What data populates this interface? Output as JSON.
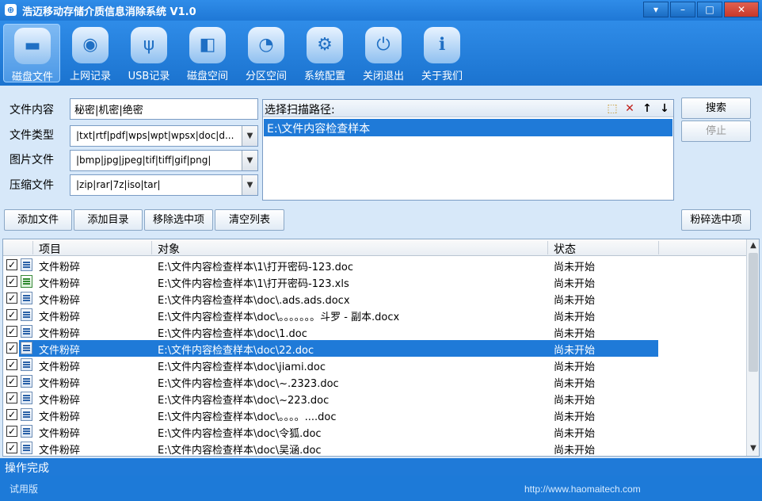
{
  "window": {
    "title": "浩迈移动存储介质信息消除系统 V1.0",
    "controls": {
      "menu": "▾",
      "min": "–",
      "max": "□",
      "close": "✕"
    }
  },
  "toolbar": {
    "items": [
      {
        "label": "磁盘文件",
        "icon": "folder-icon",
        "active": true
      },
      {
        "label": "上网记录",
        "icon": "globe-monitor-icon",
        "active": false
      },
      {
        "label": "USB记录",
        "icon": "usb-icon",
        "active": false
      },
      {
        "label": "磁盘空间",
        "icon": "disk-space-icon",
        "active": false
      },
      {
        "label": "分区空间",
        "icon": "pie-chart-icon",
        "active": false
      },
      {
        "label": "系统配置",
        "icon": "gear-icon",
        "active": false
      },
      {
        "label": "关闭退出",
        "icon": "power-icon",
        "active": false
      },
      {
        "label": "关于我们",
        "icon": "info-icon",
        "active": false
      }
    ]
  },
  "filters": {
    "content_label": "文件内容",
    "content_value": "秘密|机密|绝密",
    "type_label": "文件类型",
    "type_value": "|txt|rtf|pdf|wps|wpt|wpsx|doc|d...",
    "image_label": "图片文件",
    "image_value": "|bmp|jpg|jpeg|tif|tiff|gif|png|",
    "archive_label": "压缩文件",
    "archive_value": "|zip|rar|7z|iso|tar|"
  },
  "scan_path": {
    "header": "选择扫描路径:",
    "items": [
      "E:\\文件内容检查样本"
    ]
  },
  "actions": {
    "search": "搜索",
    "stop": "停止",
    "add_file": "添加文件",
    "add_dir": "添加目录",
    "remove_selected": "移除选中项",
    "clear_list": "清空列表",
    "shred_selected": "粉碎选中项"
  },
  "table": {
    "columns": [
      "项目",
      "对象",
      "状态"
    ],
    "rows": [
      {
        "item": "文件粉碎",
        "object": "E:\\文件内容检查样本\\1\\打开密码-123.doc",
        "status": "尚未开始",
        "checked": true,
        "type": "doc",
        "selected": false
      },
      {
        "item": "文件粉碎",
        "object": "E:\\文件内容检查样本\\1\\打开密码-123.xls",
        "status": "尚未开始",
        "checked": true,
        "type": "xls",
        "selected": false
      },
      {
        "item": "文件粉碎",
        "object": "E:\\文件内容检查样本\\doc\\.ads.ads.docx",
        "status": "尚未开始",
        "checked": true,
        "type": "doc",
        "selected": false
      },
      {
        "item": "文件粉碎",
        "object": "E:\\文件内容检查样本\\doc\\。。。。。。。斗罗 - 副本.docx",
        "status": "尚未开始",
        "checked": true,
        "type": "doc",
        "selected": false
      },
      {
        "item": "文件粉碎",
        "object": "E:\\文件内容检查样本\\doc\\1.doc",
        "status": "尚未开始",
        "checked": true,
        "type": "doc",
        "selected": false
      },
      {
        "item": "文件粉碎",
        "object": "E:\\文件内容检查样本\\doc\\22.doc",
        "status": "尚未开始",
        "checked": true,
        "type": "doc",
        "selected": true
      },
      {
        "item": "文件粉碎",
        "object": "E:\\文件内容检查样本\\doc\\jiami.doc",
        "status": "尚未开始",
        "checked": true,
        "type": "doc",
        "selected": false
      },
      {
        "item": "文件粉碎",
        "object": "E:\\文件内容检查样本\\doc\\~.2323.doc",
        "status": "尚未开始",
        "checked": true,
        "type": "doc",
        "selected": false
      },
      {
        "item": "文件粉碎",
        "object": "E:\\文件内容检查样本\\doc\\~223.doc",
        "status": "尚未开始",
        "checked": true,
        "type": "doc",
        "selected": false
      },
      {
        "item": "文件粉碎",
        "object": "E:\\文件内容检查样本\\doc\\。。。。....doc",
        "status": "尚未开始",
        "checked": true,
        "type": "doc",
        "selected": false
      },
      {
        "item": "文件粉碎",
        "object": "E:\\文件内容检查样本\\doc\\令狐.doc",
        "status": "尚未开始",
        "checked": true,
        "type": "doc",
        "selected": false
      },
      {
        "item": "文件粉碎",
        "object": "E:\\文件内容检查样本\\doc\\吴涵.doc",
        "status": "尚未开始",
        "checked": true,
        "type": "doc",
        "selected": false
      }
    ]
  },
  "status_bar": "操作完成",
  "footer": {
    "edition": "试用版",
    "url": "http://www.haomaitech.com"
  },
  "colors": {
    "accent": "#1f7ad8",
    "panel": "#d7e8f9"
  }
}
